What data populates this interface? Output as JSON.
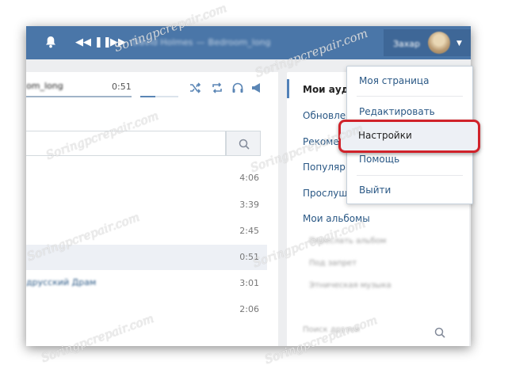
{
  "topbar": {
    "track_artist": "David Holmes",
    "track_separator": "—",
    "track_title": "Bedroom_long",
    "user_name": "Захар"
  },
  "player": {
    "track_name": "om_long",
    "time": "0:51",
    "progress": 1.0,
    "volume": 0.4
  },
  "search": {
    "placeholder": ""
  },
  "tracks": [
    {
      "title": "",
      "duration": "4:06"
    },
    {
      "title": "",
      "duration": "3:39"
    },
    {
      "title": "",
      "duration": "2:45"
    },
    {
      "title": "",
      "duration": "0:51"
    },
    {
      "title": "друсский Драм",
      "duration": "3:01"
    },
    {
      "title": "",
      "duration": "2:06"
    }
  ],
  "rightmenu": {
    "items": [
      "Мои ауди",
      "Обновле",
      "Рекоме",
      "Популяр",
      "Прослуш",
      "Мои альбомы"
    ],
    "subitems": [
      "Переслать альбом",
      "Под запрет",
      "Этническая музыка"
    ],
    "friends_placeholder": "Поиск друзей"
  },
  "dropdown": {
    "items": [
      "Моя страница",
      "Редактировать",
      "Настройки",
      "Помощь",
      "Выйти"
    ]
  },
  "watermark": "Soringpcrepair.com",
  "colors": {
    "topbar": "#4a76a8",
    "link": "#2a5885",
    "highlight_border": "#d0222a"
  }
}
